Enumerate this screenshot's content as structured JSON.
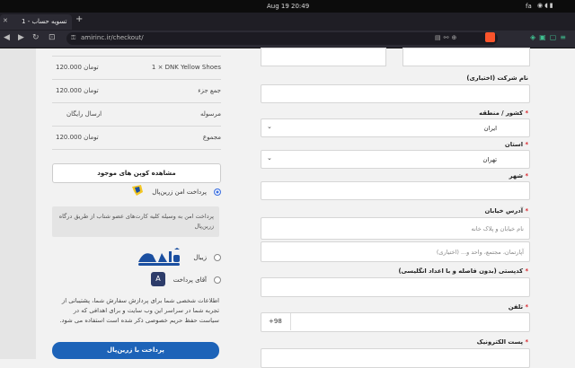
{
  "system": {
    "clock": "Aug 19  20:49",
    "lang": "fa"
  },
  "browser": {
    "tab_title": "تسویه حساب - 1",
    "url": "amirinc.ir/checkout/"
  },
  "summary": {
    "rows": [
      {
        "key": "1 × DNK Yellow Shoes",
        "value": "120.000 تومان"
      },
      {
        "key": "جمع جزء",
        "value": "120.000 تومان"
      },
      {
        "key": "مرسوله",
        "value": "ارسال رایگان"
      },
      {
        "key": "مجموع",
        "value": "120.000 تومان"
      }
    ]
  },
  "coupon_button": "مشاهده کوپن های موجود",
  "payment": {
    "zarinpal_label": "پرداخت امن زرین‌پال",
    "zarinpal_desc": "پرداخت امن به وسیله کلیه کارت‌های عضو شتاب از طریق درگاه زرین‌پال",
    "zibal_label": "زیبال",
    "aghaye_label": "آقای پرداخت",
    "privacy": "اطلاعات شخصی شما برای پردازش سفارش شما، پشتیبانی از تجربه شما در سراسر این وب سایت و برای اهدافی که در سیاست حفظ حریم خصوصی ذکر شده است استفاده می شود.",
    "pay_button": "پرداخت با زرین‌پال"
  },
  "form": {
    "company_label": "نام شرکت (اختیاری)",
    "country_label": "کشور / منطقه",
    "country_value": "ایران",
    "state_label": "استان",
    "state_value": "تهران",
    "city_label": "شهر",
    "street_label": "آدرس خیابان",
    "street_ph": "نام خیابان و پلاک خانه",
    "street2_ph": "آپارتمان، مجتمع، واحد و... (اختیاری)",
    "postcode_label": "کدپستی (بدون فاصله و با اعداد انگلیسی)",
    "phone_label": "تلفن",
    "phone_prefix": "+98",
    "email_label": "پست الکترونیک"
  },
  "colors": {
    "accent": "#1d63b8",
    "required": "#d9262c"
  }
}
